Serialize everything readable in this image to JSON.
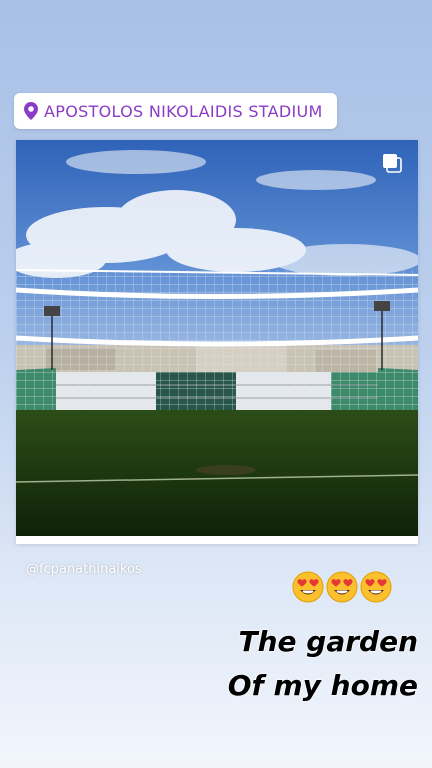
{
  "location_sticker": {
    "label": "APOSTOLOS NIKOLAIDIS STADIUM",
    "icon": "location-pin-icon",
    "accent": "#8a3cc6"
  },
  "post": {
    "username": "@fcpanathinaikos",
    "multi_photo_icon": "multi-photo-icon"
  },
  "reaction": {
    "emoji": "heart-eyes-emoji",
    "count": 3
  },
  "caption": {
    "lines": [
      "The garden",
      "Of my home"
    ]
  }
}
